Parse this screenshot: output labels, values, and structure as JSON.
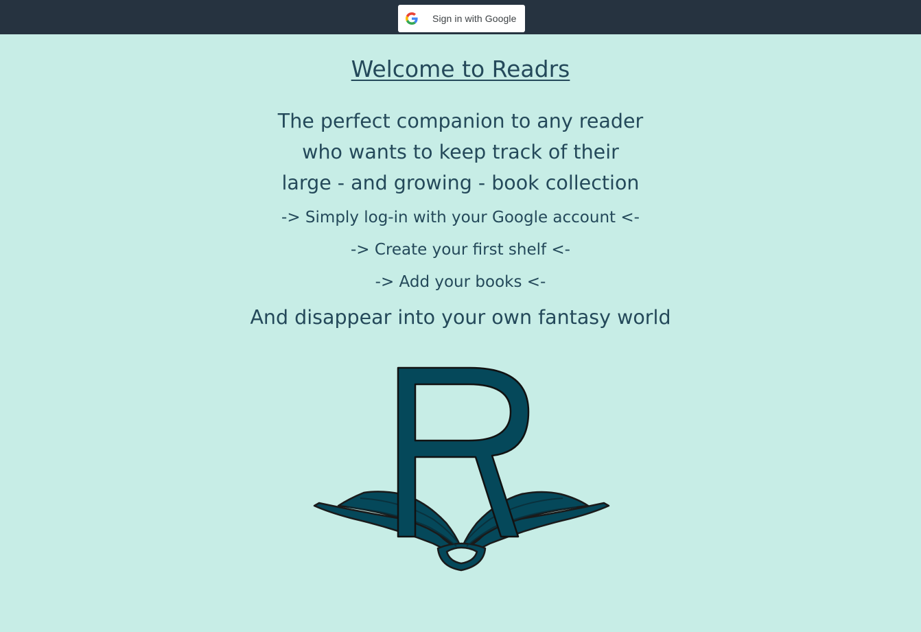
{
  "header": {
    "sign_in_label": "Sign in with Google",
    "google_icon": "google-g-icon"
  },
  "main": {
    "title": "Welcome to Readrs",
    "intro_lines": [
      "The perfect companion to any reader",
      "who wants to keep track of their",
      "large - and growing - book collection"
    ],
    "steps": [
      "-> Simply log-in with your Google account <-",
      "-> Create your first shelf <-",
      "-> Add your books <-"
    ],
    "closing": "And disappear into your own fantasy world",
    "logo_icon": "readrs-logo-book-r-icon"
  },
  "colors": {
    "topbar": "#263340",
    "background": "#c7ede6",
    "text": "#24495a",
    "logo": "#05485a"
  }
}
